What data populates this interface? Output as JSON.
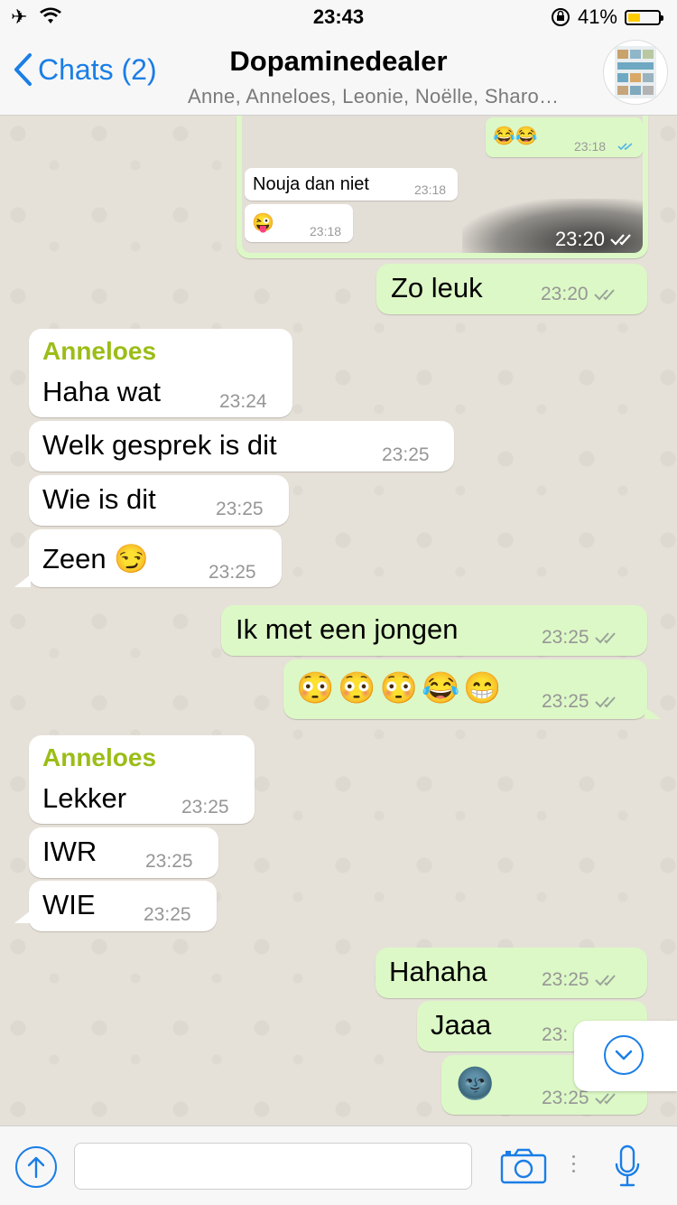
{
  "status_bar": {
    "time": "23:43",
    "battery_percent": "41%",
    "battery_level": 0.41,
    "icons": [
      "airplane-icon",
      "wifi-icon",
      "orientation-lock-icon",
      "battery-icon"
    ]
  },
  "header": {
    "back_label": "Chats (2)",
    "title": "Dopaminedealer",
    "members": "Anne, Anneloes, Leonie, Noëlle, Sharo…"
  },
  "quoted_image": {
    "bubbles": [
      {
        "text": "😂😂",
        "time": "23:18"
      },
      {
        "text": "Nouja dan niet",
        "time": "23:18"
      },
      {
        "text": "😜",
        "time": "23:18"
      }
    ],
    "time": "23:20"
  },
  "messages": [
    {
      "direction": "out",
      "text": "Zo leuk",
      "time": "23:20"
    },
    {
      "direction": "in",
      "sender": "Anneloes",
      "text": "Haha wat",
      "time": "23:24"
    },
    {
      "direction": "in",
      "text": "Welk gesprek is dit",
      "time": "23:25"
    },
    {
      "direction": "in",
      "text": "Wie is dit",
      "time": "23:25"
    },
    {
      "direction": "in",
      "text": "Zeen 😏",
      "time": "23:25"
    },
    {
      "direction": "out",
      "text": "Ik met een jongen",
      "time": "23:25"
    },
    {
      "direction": "out",
      "text": "😳😳😳😂😁",
      "time": "23:25"
    },
    {
      "direction": "in",
      "sender": "Anneloes",
      "text": "Lekker",
      "time": "23:25"
    },
    {
      "direction": "in",
      "text": "IWR",
      "time": "23:25"
    },
    {
      "direction": "in",
      "text": "WIE",
      "time": "23:25"
    },
    {
      "direction": "out",
      "text": "Hahaha",
      "time": "23:25"
    },
    {
      "direction": "out",
      "text": "Jaaa",
      "time": "23:"
    },
    {
      "direction": "out",
      "text": "🌚",
      "time": "23:25"
    }
  ],
  "input": {
    "placeholder": ""
  },
  "colors": {
    "accent": "#1a7ee6",
    "outgoing_bubble": "#dcf8c6",
    "incoming_bubble": "#ffffff",
    "sender_name": "#9bbd17",
    "chat_background": "#e6e1d8"
  }
}
